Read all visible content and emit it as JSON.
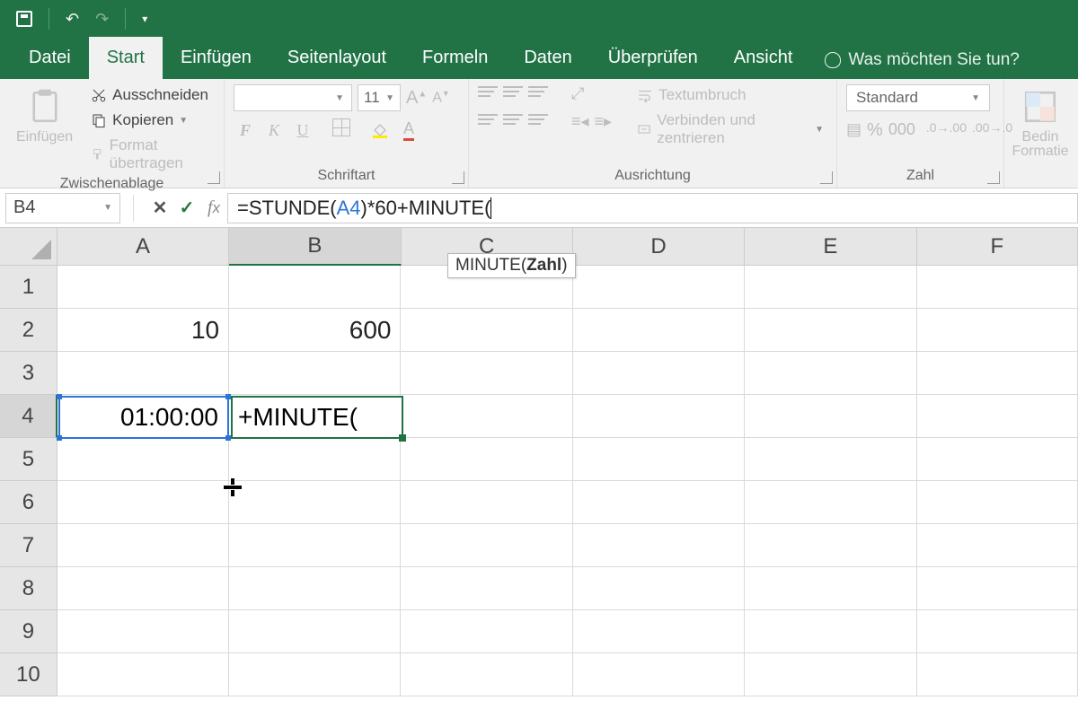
{
  "qat": {
    "undo": "↶",
    "redo": "↷",
    "customize": "▾"
  },
  "tabs": {
    "file": "Datei",
    "home": "Start",
    "insert": "Einfügen",
    "layout": "Seitenlayout",
    "formulas": "Formeln",
    "data": "Daten",
    "review": "Überprüfen",
    "view": "Ansicht",
    "tellme": "Was möchten Sie tun?"
  },
  "ribbon": {
    "clipboard": {
      "label": "Zwischenablage",
      "paste": "Einfügen",
      "cut": "Ausschneiden",
      "copy": "Kopieren",
      "fmtpainter": "Format übertragen"
    },
    "font": {
      "label": "Schriftart",
      "size": "11",
      "bold": "F",
      "italic": "K",
      "underline": "U",
      "fontA": "A"
    },
    "align": {
      "label": "Ausrichtung",
      "wrap": "Textumbruch",
      "merge": "Verbinden und zentrieren"
    },
    "number": {
      "label": "Zahl",
      "format": "Standard"
    },
    "styles": {
      "cond": "Bedin",
      "cond2": "Formatie"
    }
  },
  "formulabar": {
    "name": "B4",
    "formula_prefix": "=STUNDE(",
    "formula_ref": "A4",
    "formula_suffix": ")*60+MINUTE("
  },
  "tooltip": {
    "fn": "MINUTE(",
    "arg": "Zahl",
    "close": ")"
  },
  "columns": [
    "A",
    "B",
    "C",
    "D",
    "E",
    "F"
  ],
  "rows": [
    "1",
    "2",
    "3",
    "4",
    "5",
    "6",
    "7",
    "8",
    "9",
    "10"
  ],
  "cells": {
    "A2": "10",
    "B2": "600",
    "A4": "01:00:00",
    "B4_edit": "+MINUTE("
  },
  "selected_col": "B",
  "selected_row": "4"
}
